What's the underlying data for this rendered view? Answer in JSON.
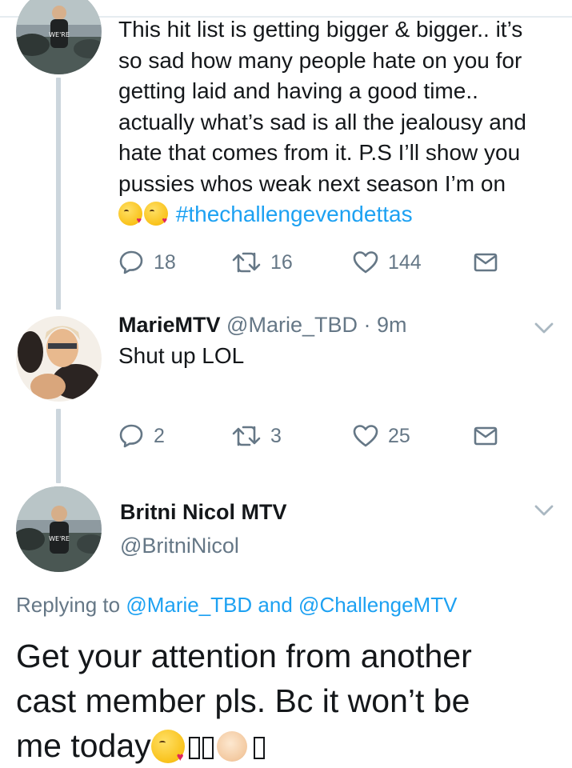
{
  "tweet1": {
    "text_lines": [
      "This hit list is getting bigger & bigger.. it’s",
      "so sad how many people hate on you for",
      "getting laid and having a good time..",
      "actually what’s sad is all the jealousy and",
      "hate that comes from it. P.S I’ll show you",
      "pussies whos weak next season I’m on"
    ],
    "hashtag": "#thechallengevendettas",
    "emojis": [
      "kissing-face-emoji",
      "kissing-face-emoji"
    ],
    "replies": "18",
    "retweets": "16",
    "likes": "144"
  },
  "tweet2": {
    "name": "MarieMTV",
    "handle": "@Marie_TBD",
    "separator": "·",
    "time": "9m",
    "text": "Shut up LOL",
    "replies": "2",
    "retweets": "3",
    "likes": "25"
  },
  "main_tweet": {
    "name": "Britni Nicol MTV",
    "handle": "@BritniNicol",
    "replying_prefix": "Replying to",
    "mention1": "@Marie_TBD",
    "and_word": "and",
    "mention2": "@ChallengeMTV",
    "text_line1": "Get your attention from another",
    "text_line2": "cast member pls. Bc it won’t be",
    "text_line3": "me today"
  },
  "colors": {
    "link": "#1da1f2",
    "muted": "#657786",
    "text": "#14171a",
    "thread_line": "#ccd6dd"
  }
}
